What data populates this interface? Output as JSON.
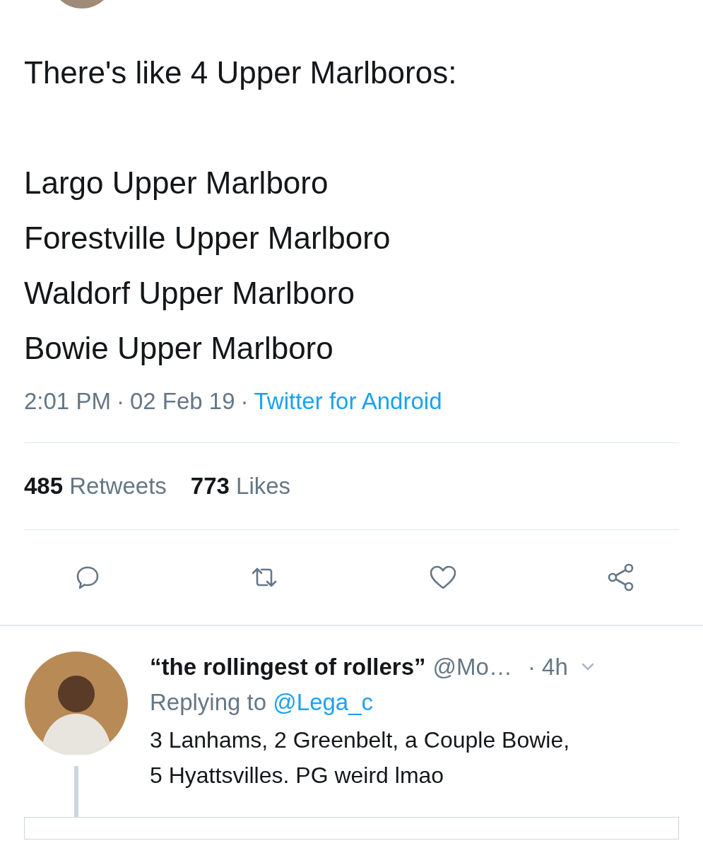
{
  "tweet": {
    "intro": "There's like 4 Upper Marlboros:",
    "lines": [
      "Largo Upper Marlboro",
      "Forestville Upper Marlboro",
      "Waldorf Upper Marlboro",
      "Bowie Upper Marlboro"
    ],
    "meta": {
      "time": "2:01 PM",
      "separator": "·",
      "date": "02 Feb 19",
      "source": "Twitter for Android"
    },
    "stats": [
      {
        "count": "485",
        "label": "Retweets"
      },
      {
        "count": "773",
        "label": "Likes"
      }
    ],
    "actions": [
      {
        "kind": "reply"
      },
      {
        "kind": "retweet"
      },
      {
        "kind": "like"
      },
      {
        "kind": "share"
      }
    ]
  },
  "reply": {
    "name": "“the rollingest of rollers”",
    "handle": "@Mo…",
    "time": "· 4h",
    "replying_prefix": "Replying to",
    "replying_handle": "@Lega_c",
    "lines": [
      "3 Lanhams, 2 Greenbelt, a Couple Bowie,",
      "5 Hyattsvilles. PG weird lmao"
    ]
  }
}
